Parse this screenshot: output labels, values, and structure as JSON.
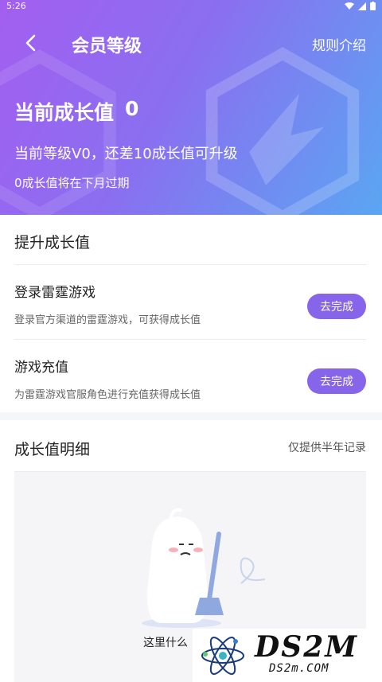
{
  "statusbar": {
    "time": "5:26"
  },
  "header": {
    "title": "会员等级",
    "rules_link": "规则介绍",
    "growth_label": "当前成长值",
    "growth_value": "0",
    "level_info": "当前等级V0，还差10成长值可升级",
    "expire_info": "0成长值将在下月过期"
  },
  "boost": {
    "title": "提升成长值",
    "tasks": [
      {
        "title": "登录雷霆游戏",
        "desc": "登录官方渠道的雷霆游戏，可获得成长值",
        "button": "去完成"
      },
      {
        "title": "游戏充值",
        "desc": "为雷霆游戏官服角色进行充值获得成长值",
        "button": "去完成"
      }
    ]
  },
  "detail": {
    "title": "成长值明细",
    "note": "仅提供半年记录",
    "empty_text": "这里什么"
  },
  "watermark": {
    "big": "DS2M",
    "small": "DS2m.COM"
  },
  "colors": {
    "accent": "#8665ea",
    "header_start": "#a35ef0",
    "header_end": "#5aa6f2"
  },
  "icons": [
    "back-arrow-icon",
    "wifi-icon",
    "signal-icon",
    "battery-icon"
  ]
}
